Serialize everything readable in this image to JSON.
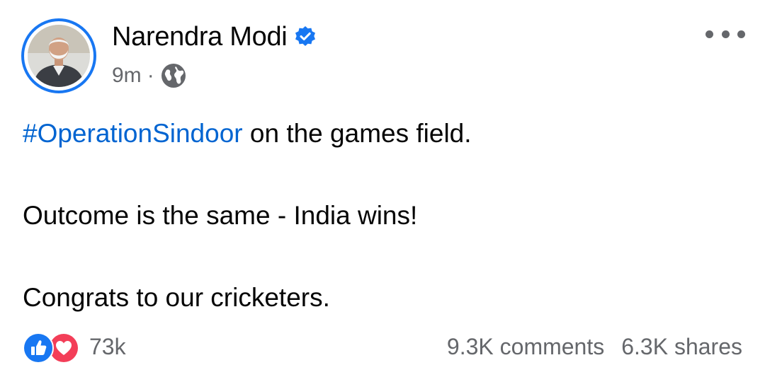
{
  "post": {
    "author": {
      "name": "Narendra Modi",
      "verified": true
    },
    "meta": {
      "time": "9m",
      "separator": "·",
      "audience_icon": "globe-icon"
    },
    "more_icon": "more-horizontal-icon",
    "content": {
      "hashtag": "#OperationSindoor",
      "line1_rest": " on the games field.",
      "line2": "Outcome is the same - India wins!",
      "line3": "Congrats to our cricketers."
    },
    "footer": {
      "reaction_icons": [
        "like-icon",
        "love-icon"
      ],
      "reaction_count": "73k",
      "comments": "9.3K comments",
      "shares": "6.3K shares"
    }
  },
  "colors": {
    "accent_blue": "#1877f2",
    "hashtag_blue": "#0064d1",
    "love_red": "#f33e58",
    "secondary_text": "#65676b",
    "primary_text": "#050505"
  }
}
